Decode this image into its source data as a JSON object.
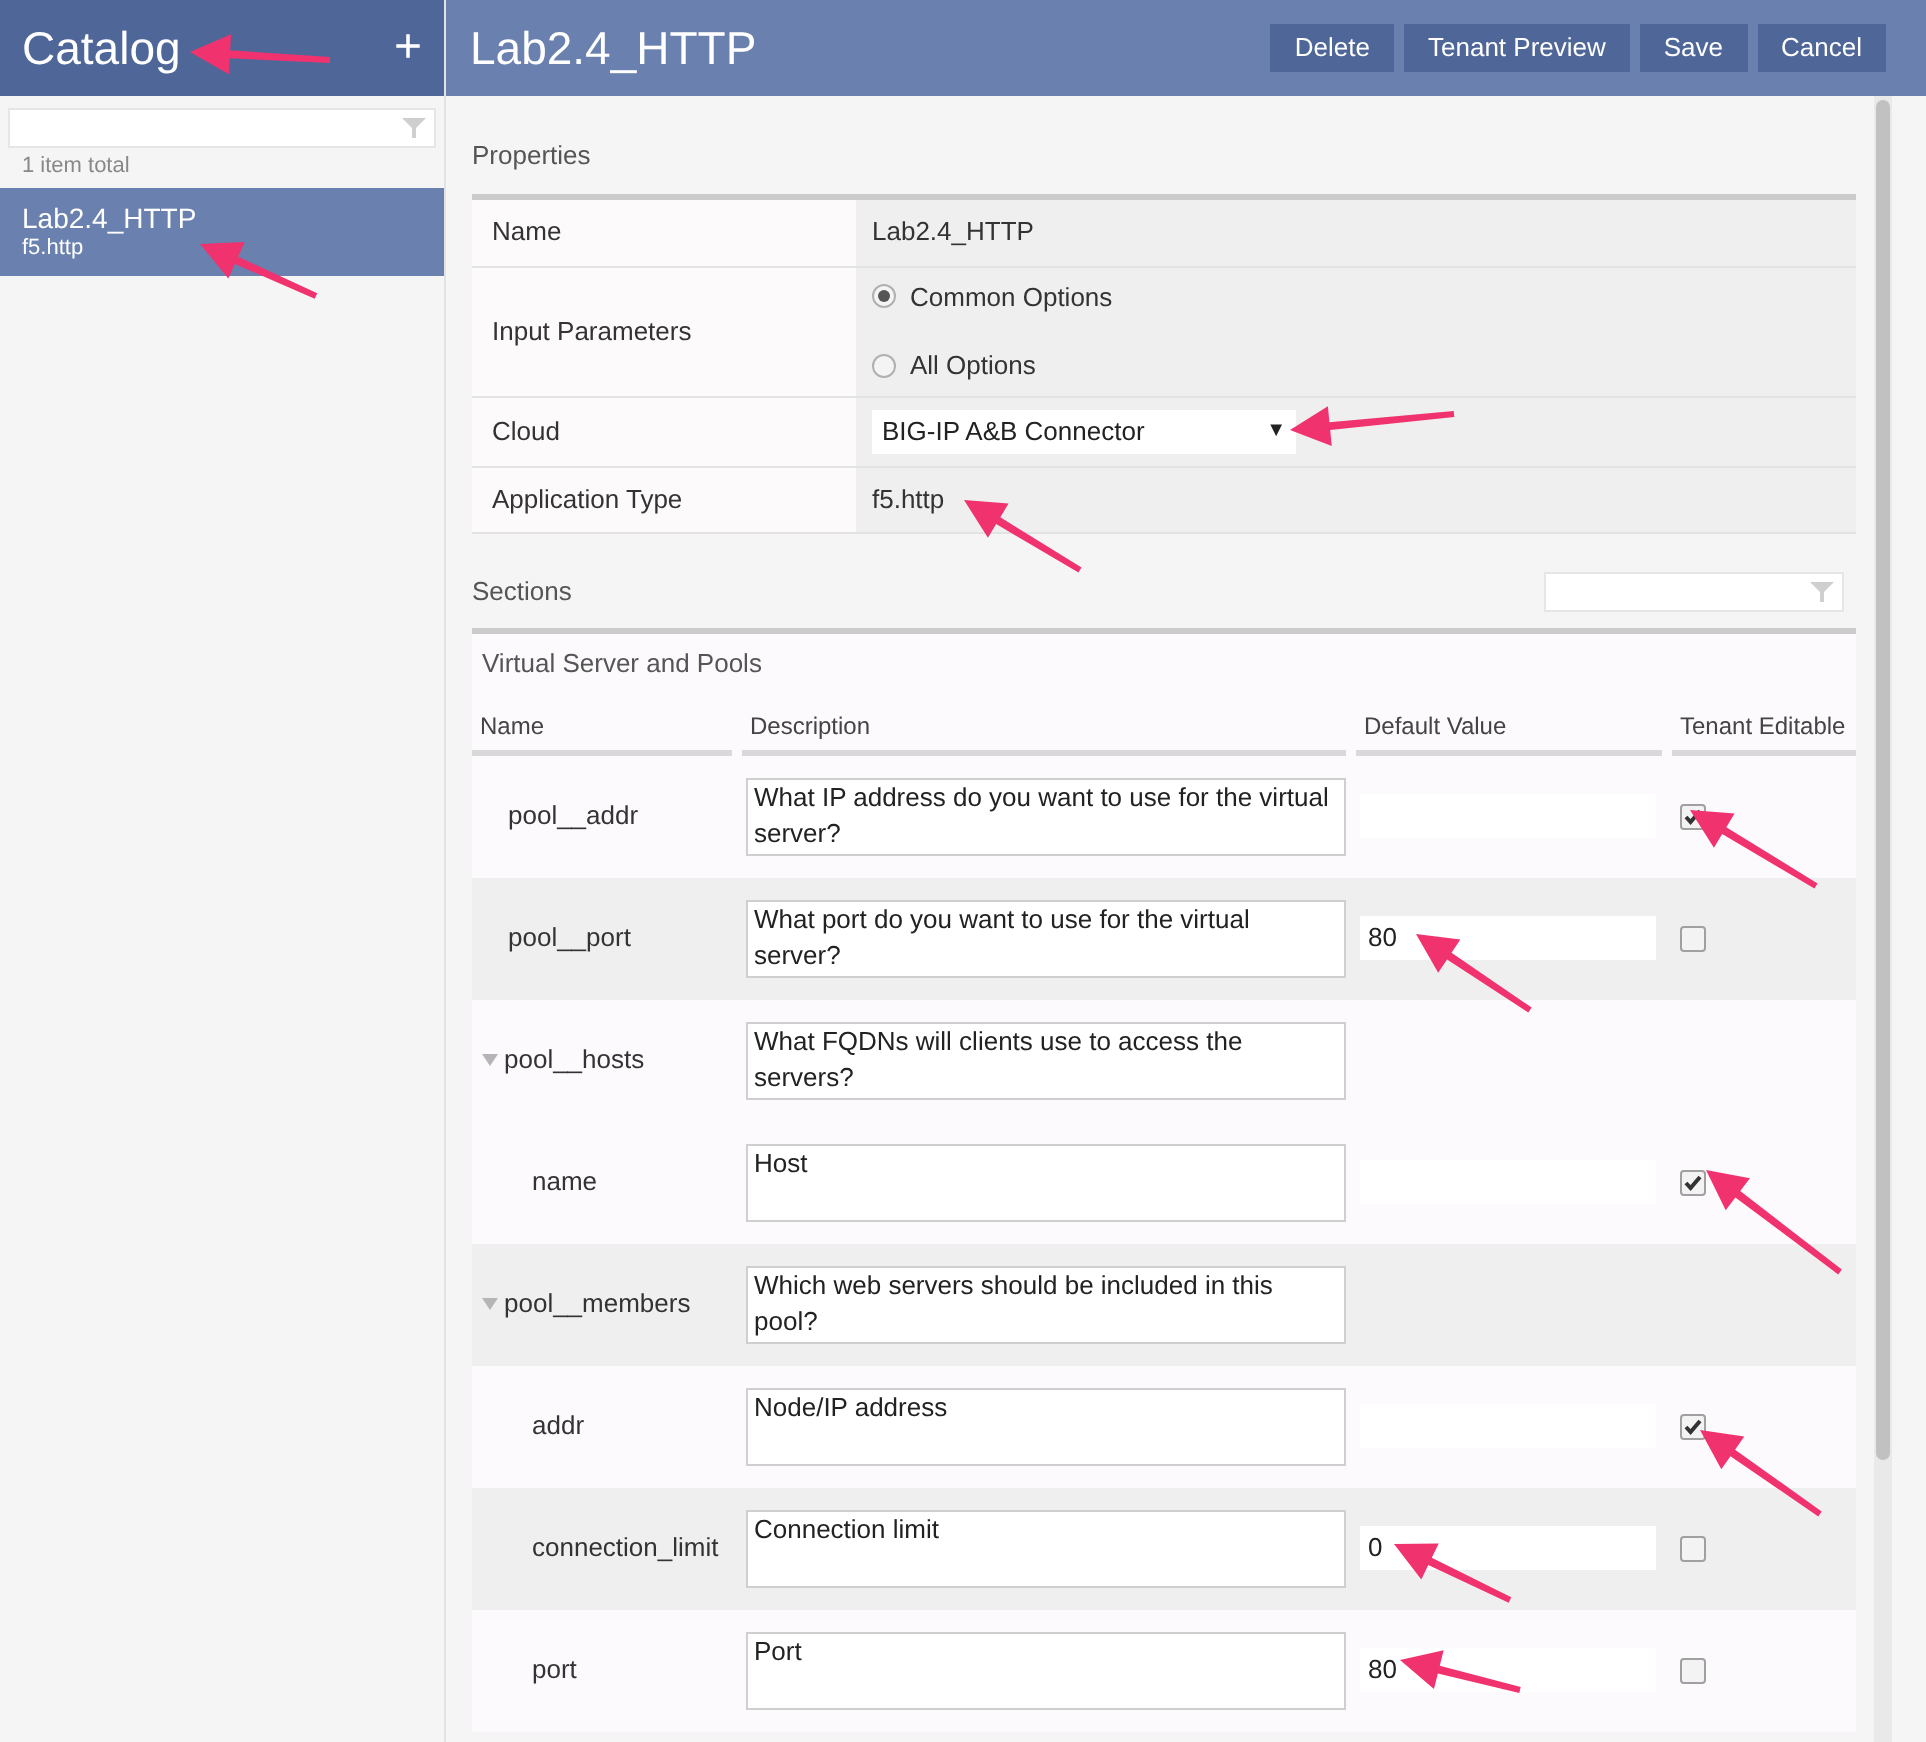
{
  "sidebar": {
    "title": "Catalog",
    "add_label": "+",
    "count": "1 item total",
    "items": [
      {
        "name": "Lab2.4_HTTP",
        "type": "f5.http",
        "selected": true
      }
    ]
  },
  "header": {
    "title": "Lab2.4_HTTP",
    "buttons": [
      "Delete",
      "Tenant Preview",
      "Save",
      "Cancel"
    ]
  },
  "properties": {
    "title": "Properties",
    "name": {
      "label": "Name",
      "value": "Lab2.4_HTTP"
    },
    "input_parameters": {
      "label": "Input Parameters",
      "options": [
        {
          "label": "Common Options",
          "selected": true
        },
        {
          "label": "All Options",
          "selected": false
        }
      ]
    },
    "cloud": {
      "label": "Cloud",
      "value": "BIG-IP A&B Connector",
      "caret": "▼"
    },
    "application_type": {
      "label": "Application Type",
      "value": "f5.http"
    }
  },
  "sections": {
    "title": "Sections",
    "section_title": "Virtual Server and Pools",
    "columns": [
      "Name",
      "Description",
      "Default Value",
      "Tenant Editable"
    ],
    "rows": [
      {
        "kind": "field",
        "name": "pool__addr",
        "description": "What IP address do you want to use for the virtual server?",
        "tenant_editable": true
      },
      {
        "kind": "field",
        "name": "pool__port",
        "description": "What port do you want to use for the virtual server?",
        "default_value": "80",
        "tenant_editable": false
      },
      {
        "kind": "group",
        "name": "pool__hosts",
        "description": "What FQDNs will clients use to access the servers?",
        "expanded": true,
        "children": [
          {
            "kind": "field",
            "name": "name",
            "description": "Host",
            "tenant_editable": true
          }
        ]
      },
      {
        "kind": "group",
        "name": "pool__members",
        "description": "Which web servers should be included in this pool?",
        "expanded": true,
        "children": [
          {
            "kind": "field",
            "name": "addr",
            "description": "Node/IP address",
            "tenant_editable": true
          },
          {
            "kind": "field",
            "name": "connection_limit",
            "description": "Connection limit",
            "default_value": "0",
            "tenant_editable": false
          },
          {
            "kind": "field",
            "name": "port",
            "description": "Port",
            "default_value": "80",
            "tenant_editable": false
          }
        ]
      }
    ]
  }
}
